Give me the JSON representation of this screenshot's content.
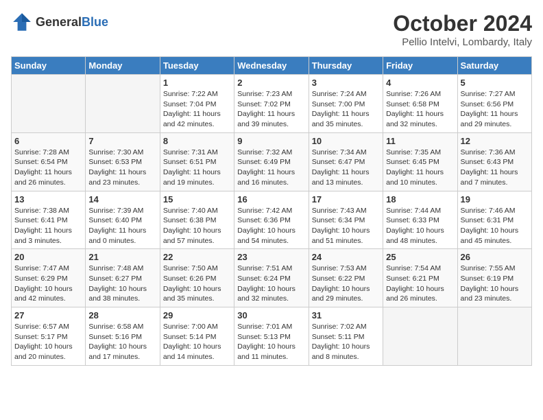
{
  "header": {
    "logo_general": "General",
    "logo_blue": "Blue",
    "month_title": "October 2024",
    "location": "Pellio Intelvi, Lombardy, Italy"
  },
  "days_of_week": [
    "Sunday",
    "Monday",
    "Tuesday",
    "Wednesday",
    "Thursday",
    "Friday",
    "Saturday"
  ],
  "weeks": [
    [
      {
        "day": "",
        "empty": true
      },
      {
        "day": "",
        "empty": true
      },
      {
        "day": "1",
        "sunrise": "Sunrise: 7:22 AM",
        "sunset": "Sunset: 7:04 PM",
        "daylight": "Daylight: 11 hours and 42 minutes."
      },
      {
        "day": "2",
        "sunrise": "Sunrise: 7:23 AM",
        "sunset": "Sunset: 7:02 PM",
        "daylight": "Daylight: 11 hours and 39 minutes."
      },
      {
        "day": "3",
        "sunrise": "Sunrise: 7:24 AM",
        "sunset": "Sunset: 7:00 PM",
        "daylight": "Daylight: 11 hours and 35 minutes."
      },
      {
        "day": "4",
        "sunrise": "Sunrise: 7:26 AM",
        "sunset": "Sunset: 6:58 PM",
        "daylight": "Daylight: 11 hours and 32 minutes."
      },
      {
        "day": "5",
        "sunrise": "Sunrise: 7:27 AM",
        "sunset": "Sunset: 6:56 PM",
        "daylight": "Daylight: 11 hours and 29 minutes."
      }
    ],
    [
      {
        "day": "6",
        "sunrise": "Sunrise: 7:28 AM",
        "sunset": "Sunset: 6:54 PM",
        "daylight": "Daylight: 11 hours and 26 minutes."
      },
      {
        "day": "7",
        "sunrise": "Sunrise: 7:30 AM",
        "sunset": "Sunset: 6:53 PM",
        "daylight": "Daylight: 11 hours and 23 minutes."
      },
      {
        "day": "8",
        "sunrise": "Sunrise: 7:31 AM",
        "sunset": "Sunset: 6:51 PM",
        "daylight": "Daylight: 11 hours and 19 minutes."
      },
      {
        "day": "9",
        "sunrise": "Sunrise: 7:32 AM",
        "sunset": "Sunset: 6:49 PM",
        "daylight": "Daylight: 11 hours and 16 minutes."
      },
      {
        "day": "10",
        "sunrise": "Sunrise: 7:34 AM",
        "sunset": "Sunset: 6:47 PM",
        "daylight": "Daylight: 11 hours and 13 minutes."
      },
      {
        "day": "11",
        "sunrise": "Sunrise: 7:35 AM",
        "sunset": "Sunset: 6:45 PM",
        "daylight": "Daylight: 11 hours and 10 minutes."
      },
      {
        "day": "12",
        "sunrise": "Sunrise: 7:36 AM",
        "sunset": "Sunset: 6:43 PM",
        "daylight": "Daylight: 11 hours and 7 minutes."
      }
    ],
    [
      {
        "day": "13",
        "sunrise": "Sunrise: 7:38 AM",
        "sunset": "Sunset: 6:41 PM",
        "daylight": "Daylight: 11 hours and 3 minutes."
      },
      {
        "day": "14",
        "sunrise": "Sunrise: 7:39 AM",
        "sunset": "Sunset: 6:40 PM",
        "daylight": "Daylight: 11 hours and 0 minutes."
      },
      {
        "day": "15",
        "sunrise": "Sunrise: 7:40 AM",
        "sunset": "Sunset: 6:38 PM",
        "daylight": "Daylight: 10 hours and 57 minutes."
      },
      {
        "day": "16",
        "sunrise": "Sunrise: 7:42 AM",
        "sunset": "Sunset: 6:36 PM",
        "daylight": "Daylight: 10 hours and 54 minutes."
      },
      {
        "day": "17",
        "sunrise": "Sunrise: 7:43 AM",
        "sunset": "Sunset: 6:34 PM",
        "daylight": "Daylight: 10 hours and 51 minutes."
      },
      {
        "day": "18",
        "sunrise": "Sunrise: 7:44 AM",
        "sunset": "Sunset: 6:33 PM",
        "daylight": "Daylight: 10 hours and 48 minutes."
      },
      {
        "day": "19",
        "sunrise": "Sunrise: 7:46 AM",
        "sunset": "Sunset: 6:31 PM",
        "daylight": "Daylight: 10 hours and 45 minutes."
      }
    ],
    [
      {
        "day": "20",
        "sunrise": "Sunrise: 7:47 AM",
        "sunset": "Sunset: 6:29 PM",
        "daylight": "Daylight: 10 hours and 42 minutes."
      },
      {
        "day": "21",
        "sunrise": "Sunrise: 7:48 AM",
        "sunset": "Sunset: 6:27 PM",
        "daylight": "Daylight: 10 hours and 38 minutes."
      },
      {
        "day": "22",
        "sunrise": "Sunrise: 7:50 AM",
        "sunset": "Sunset: 6:26 PM",
        "daylight": "Daylight: 10 hours and 35 minutes."
      },
      {
        "day": "23",
        "sunrise": "Sunrise: 7:51 AM",
        "sunset": "Sunset: 6:24 PM",
        "daylight": "Daylight: 10 hours and 32 minutes."
      },
      {
        "day": "24",
        "sunrise": "Sunrise: 7:53 AM",
        "sunset": "Sunset: 6:22 PM",
        "daylight": "Daylight: 10 hours and 29 minutes."
      },
      {
        "day": "25",
        "sunrise": "Sunrise: 7:54 AM",
        "sunset": "Sunset: 6:21 PM",
        "daylight": "Daylight: 10 hours and 26 minutes."
      },
      {
        "day": "26",
        "sunrise": "Sunrise: 7:55 AM",
        "sunset": "Sunset: 6:19 PM",
        "daylight": "Daylight: 10 hours and 23 minutes."
      }
    ],
    [
      {
        "day": "27",
        "sunrise": "Sunrise: 6:57 AM",
        "sunset": "Sunset: 5:17 PM",
        "daylight": "Daylight: 10 hours and 20 minutes."
      },
      {
        "day": "28",
        "sunrise": "Sunrise: 6:58 AM",
        "sunset": "Sunset: 5:16 PM",
        "daylight": "Daylight: 10 hours and 17 minutes."
      },
      {
        "day": "29",
        "sunrise": "Sunrise: 7:00 AM",
        "sunset": "Sunset: 5:14 PM",
        "daylight": "Daylight: 10 hours and 14 minutes."
      },
      {
        "day": "30",
        "sunrise": "Sunrise: 7:01 AM",
        "sunset": "Sunset: 5:13 PM",
        "daylight": "Daylight: 10 hours and 11 minutes."
      },
      {
        "day": "31",
        "sunrise": "Sunrise: 7:02 AM",
        "sunset": "Sunset: 5:11 PM",
        "daylight": "Daylight: 10 hours and 8 minutes."
      },
      {
        "day": "",
        "empty": true
      },
      {
        "day": "",
        "empty": true
      }
    ]
  ]
}
